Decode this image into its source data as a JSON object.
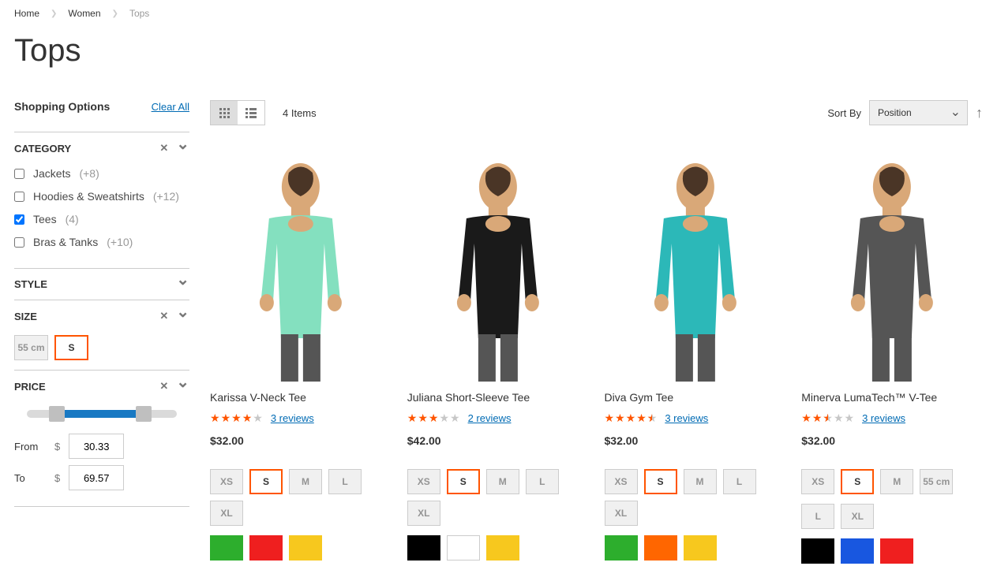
{
  "breadcrumb": {
    "home": "Home",
    "women": "Women",
    "tops": "Tops"
  },
  "page_title": "Tops",
  "sidebar": {
    "shopping_options": "Shopping Options",
    "clear_all": "Clear All",
    "filters": {
      "category": {
        "title": "CATEGORY",
        "options": [
          {
            "label": "Jackets",
            "count": "(+8)",
            "checked": false
          },
          {
            "label": "Hoodies & Sweatshirts",
            "count": "(+12)",
            "checked": false
          },
          {
            "label": "Tees",
            "count": "(4)",
            "checked": true
          },
          {
            "label": "Bras & Tanks",
            "count": "(+10)",
            "checked": false
          }
        ]
      },
      "style": {
        "title": "STYLE"
      },
      "size": {
        "title": "SIZE",
        "options": [
          "55 cm",
          "S"
        ]
      },
      "price": {
        "title": "PRICE",
        "from_label": "From",
        "to_label": "To",
        "currency": "$",
        "from": "30.33",
        "to": "69.57",
        "slider_min_pct": 20,
        "slider_max_pct": 78
      }
    }
  },
  "toolbar": {
    "item_count": "4 Items",
    "sort_by_label": "Sort By",
    "sort_value": "Position"
  },
  "products": [
    {
      "name": "Karissa V-Neck Tee",
      "rating": 4,
      "reviews": "3 reviews",
      "price": "$32.00",
      "sizes": [
        "XS",
        "S",
        "M",
        "L",
        "XL"
      ],
      "selected_size": "S",
      "colors": [
        "#2dae2d",
        "#ef1f1f",
        "#f7c81e"
      ],
      "shirt": "#84e0bf"
    },
    {
      "name": "Juliana Short-Sleeve Tee",
      "rating": 3,
      "reviews": "2 reviews",
      "price": "$42.00",
      "sizes": [
        "XS",
        "S",
        "M",
        "L",
        "XL"
      ],
      "selected_size": "S",
      "colors": [
        "#000000",
        "#ffffff",
        "#f7c81e"
      ],
      "shirt": "#1a1a1a"
    },
    {
      "name": "Diva Gym Tee",
      "rating": 4.5,
      "reviews": "3 reviews",
      "price": "$32.00",
      "sizes": [
        "XS",
        "S",
        "M",
        "L",
        "XL"
      ],
      "selected_size": "S",
      "colors": [
        "#2dae2d",
        "#ff6600",
        "#f7c81e"
      ],
      "shirt": "#2cb8b8"
    },
    {
      "name": "Minerva LumaTech™ V-Tee",
      "rating": 2.5,
      "reviews": "3 reviews",
      "price": "$32.00",
      "sizes": [
        "XS",
        "S",
        "M",
        "55 cm"
      ],
      "selected_size": "S",
      "extra_sizes": [
        "L",
        "XL"
      ],
      "colors": [
        "#000000",
        "#1857e0",
        "#ef1f1f"
      ],
      "shirt": "#555555"
    }
  ]
}
